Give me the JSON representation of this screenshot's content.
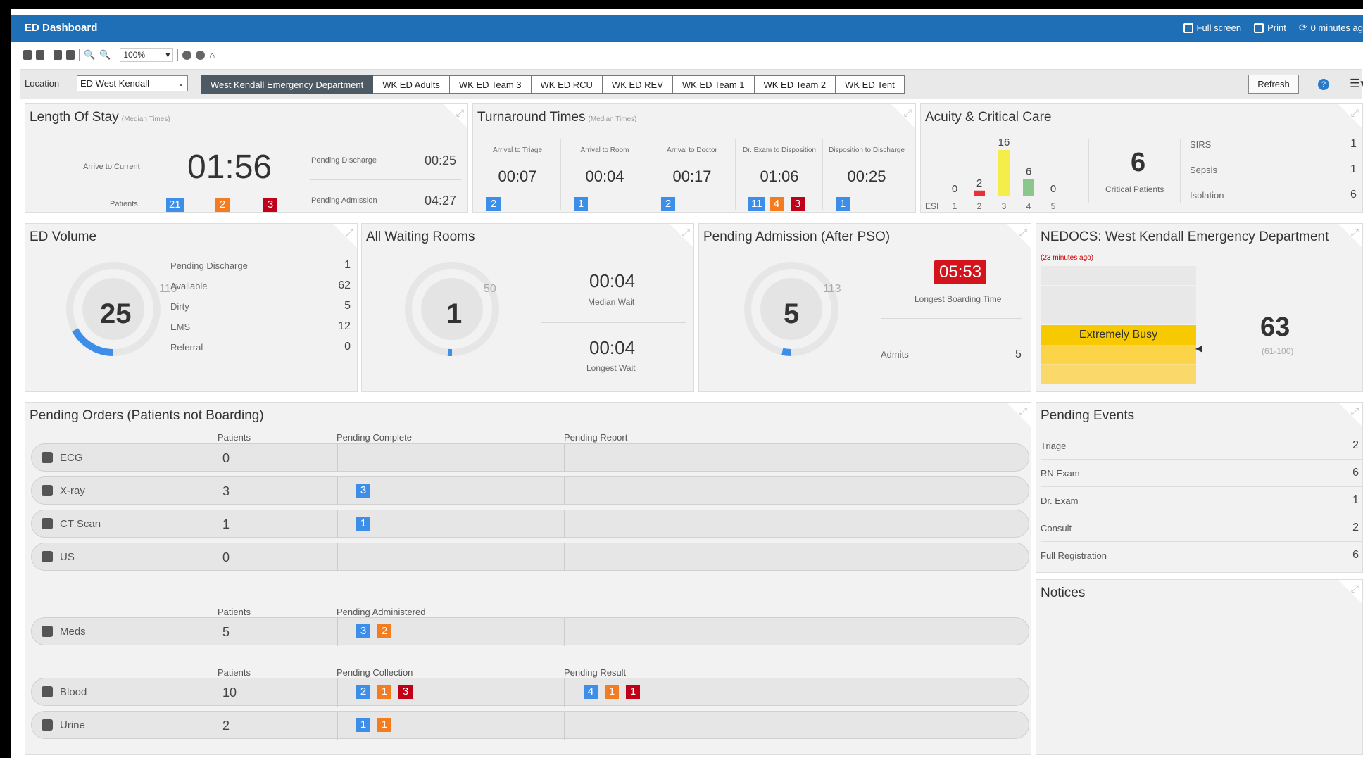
{
  "app": {
    "title": "ED Dashboard",
    "fullscreen": "Full screen",
    "print": "Print",
    "updated": "0 minutes ag"
  },
  "toolbar": {
    "zoom": "100%"
  },
  "location": {
    "label": "Location",
    "value": "ED West Kendall",
    "tabs": [
      "West Kendall Emergency Department",
      "WK ED Adults",
      "WK ED Team 3",
      "WK ED RCU",
      "WK ED REV",
      "WK ED Team 1",
      "WK ED Team 2",
      "WK ED Tent"
    ],
    "refresh": "Refresh"
  },
  "los": {
    "title": "Length Of Stay",
    "subtitle": "(Median Times)",
    "arrive_label": "Arrive to Current",
    "arrive_value": "01:56",
    "patients_label": "Patients",
    "badges": [
      "21",
      "2",
      "3"
    ],
    "pd_label": "Pending Discharge",
    "pd_value": "00:25",
    "pa_label": "Pending Admission",
    "pa_value": "04:27"
  },
  "turnaround": {
    "title": "Turnaround Times",
    "subtitle": "(Median Times)",
    "cols": [
      {
        "label": "Arrival to Triage",
        "value": "00:07",
        "badges": [
          {
            "v": "2",
            "c": "b"
          }
        ]
      },
      {
        "label": "Arrival to Room",
        "value": "00:04",
        "badges": [
          {
            "v": "1",
            "c": "b"
          }
        ]
      },
      {
        "label": "Arrival to Doctor",
        "value": "00:17",
        "badges": [
          {
            "v": "2",
            "c": "b"
          }
        ]
      },
      {
        "label": "Dr. Exam to Disposition",
        "value": "01:06",
        "badges": [
          {
            "v": "11",
            "c": "b"
          },
          {
            "v": "4",
            "c": "o"
          },
          {
            "v": "3",
            "c": "r"
          }
        ]
      },
      {
        "label": "Disposition to Discharge",
        "value": "00:25",
        "badges": [
          {
            "v": "1",
            "c": "b"
          }
        ]
      }
    ]
  },
  "acuity": {
    "title": "Acuity & Critical Care",
    "esi_label": "ESI",
    "levels": [
      "1",
      "2",
      "3",
      "4",
      "5"
    ],
    "counts": [
      0,
      2,
      16,
      6,
      0
    ],
    "count_labels": [
      "0",
      "2",
      "16",
      "6",
      "0"
    ],
    "colors": [
      "#c00018",
      "#e8303a",
      "#f5ee4a",
      "#8cc68c",
      "#aaaaaa"
    ],
    "critical_value": "6",
    "critical_label": "Critical Patients",
    "flags": [
      {
        "label": "SIRS",
        "value": "1"
      },
      {
        "label": "Sepsis",
        "value": "1"
      },
      {
        "label": "Isolation",
        "value": "6"
      }
    ]
  },
  "volume": {
    "title": "ED Volume",
    "value": "25",
    "max": "110",
    "fill": 0.227,
    "rows": [
      {
        "label": "Pending Discharge",
        "value": "1"
      },
      {
        "label": "Available",
        "value": "62"
      },
      {
        "label": "Dirty",
        "value": "5"
      },
      {
        "label": "EMS",
        "value": "12"
      },
      {
        "label": "Referral",
        "value": "0"
      }
    ]
  },
  "waiting": {
    "title": "All Waiting Rooms",
    "value": "1",
    "max": "50",
    "fill": 0.02,
    "median": "00:04",
    "median_label": "Median Wait",
    "longest": "00:04",
    "longest_label": "Longest Wait"
  },
  "pending_adm": {
    "title": "Pending Admission (After PSO)",
    "value": "5",
    "max": "113",
    "fill": 0.044,
    "boarding": "05:53",
    "boarding_label": "Longest Boarding Time",
    "admits_label": "Admits",
    "admits": "5"
  },
  "nedocs": {
    "title": "NEDOCS: West Kendall Emergency Department",
    "ago": "(23 minutes ago)",
    "status": "Extremely Busy",
    "score": "63",
    "range": "(61-100)"
  },
  "orders": {
    "title": "Pending Orders (Patients not Boarding)",
    "h_patients": "Patients",
    "h_complete": "Pending Complete",
    "h_report": "Pending Report",
    "h_administered": "Pending Administered",
    "h_collection": "Pending Collection",
    "h_result": "Pending Result",
    "imaging": [
      {
        "name": "ECG",
        "icon": "ecg-icon",
        "patients": "0",
        "complete": [],
        "report": []
      },
      {
        "name": "X-ray",
        "icon": "radiation-icon",
        "patients": "3",
        "complete": [
          {
            "v": "3",
            "c": "b"
          }
        ],
        "report": []
      },
      {
        "name": "CT Scan",
        "icon": "ct-scan-icon",
        "patients": "1",
        "complete": [
          {
            "v": "1",
            "c": "b"
          }
        ],
        "report": []
      },
      {
        "name": "US",
        "icon": "ultrasound-icon",
        "patients": "0",
        "complete": [],
        "report": []
      }
    ],
    "meds": {
      "name": "Meds",
      "icon": "syringe-icon",
      "patients": "5",
      "administered": [
        {
          "v": "3",
          "c": "b"
        },
        {
          "v": "2",
          "c": "o"
        }
      ]
    },
    "labs": [
      {
        "name": "Blood",
        "icon": "blood-drop-icon",
        "patients": "10",
        "collection": [
          {
            "v": "2",
            "c": "b"
          },
          {
            "v": "1",
            "c": "o"
          },
          {
            "v": "3",
            "c": "r"
          }
        ],
        "result": [
          {
            "v": "4",
            "c": "b"
          },
          {
            "v": "1",
            "c": "o"
          },
          {
            "v": "1",
            "c": "r"
          }
        ]
      },
      {
        "name": "Urine",
        "icon": "urine-cup-icon",
        "patients": "2",
        "collection": [
          {
            "v": "1",
            "c": "b"
          },
          {
            "v": "1",
            "c": "o"
          }
        ],
        "result": []
      }
    ]
  },
  "events": {
    "title": "Pending Events",
    "items": [
      {
        "label": "Triage",
        "value": "2"
      },
      {
        "label": "RN Exam",
        "value": "6"
      },
      {
        "label": "Dr. Exam",
        "value": "1"
      },
      {
        "label": "Consult",
        "value": "2"
      },
      {
        "label": "Full Registration",
        "value": "6"
      }
    ]
  },
  "notices": {
    "title": "Notices"
  }
}
